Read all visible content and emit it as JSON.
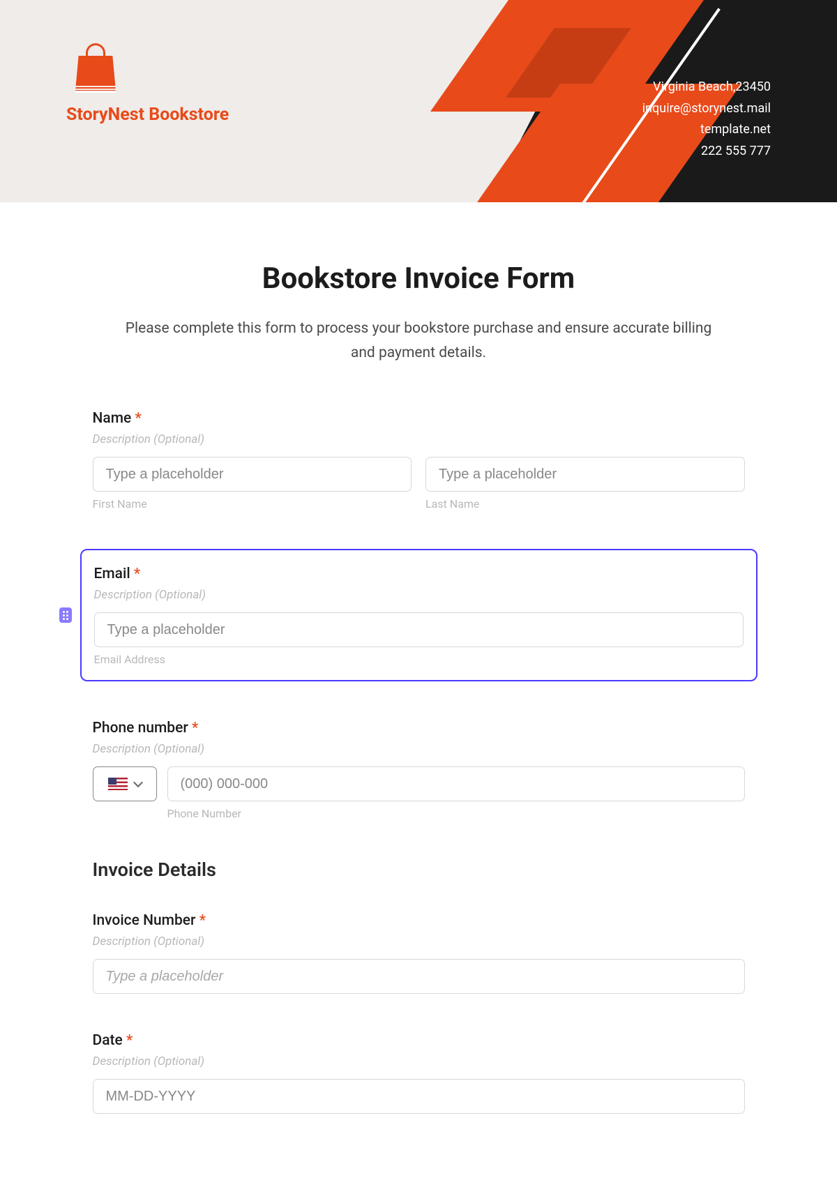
{
  "header": {
    "brand_name": "StoryNest Bookstore",
    "contact": {
      "address": "Virginia Beach,23450",
      "email": "inquire@storynest.mail",
      "website": "template.net",
      "phone": "222 555 777"
    }
  },
  "form": {
    "title": "Bookstore Invoice Form",
    "description": "Please complete this form to process your bookstore purchase and ensure accurate billing and payment details.",
    "fields": {
      "name": {
        "label": "Name",
        "required": "*",
        "desc": "Description (Optional)",
        "first_placeholder": "Type a placeholder",
        "first_sublabel": "First Name",
        "last_placeholder": "Type a placeholder",
        "last_sublabel": "Last Name"
      },
      "email": {
        "label": "Email",
        "required": "*",
        "desc": "Description (Optional)",
        "placeholder": "Type a placeholder",
        "sublabel": "Email Address"
      },
      "phone": {
        "label": "Phone number",
        "required": "*",
        "desc": "Description (Optional)",
        "placeholder": "(000) 000-000",
        "sublabel": "Phone Number"
      },
      "invoice_section": "Invoice Details",
      "invoice_number": {
        "label": "Invoice Number",
        "required": "*",
        "desc": "Description (Optional)",
        "placeholder": "Type a placeholder"
      },
      "date": {
        "label": "Date",
        "required": "*",
        "desc": "Description (Optional)",
        "placeholder": "MM-DD-YYYY"
      }
    }
  }
}
